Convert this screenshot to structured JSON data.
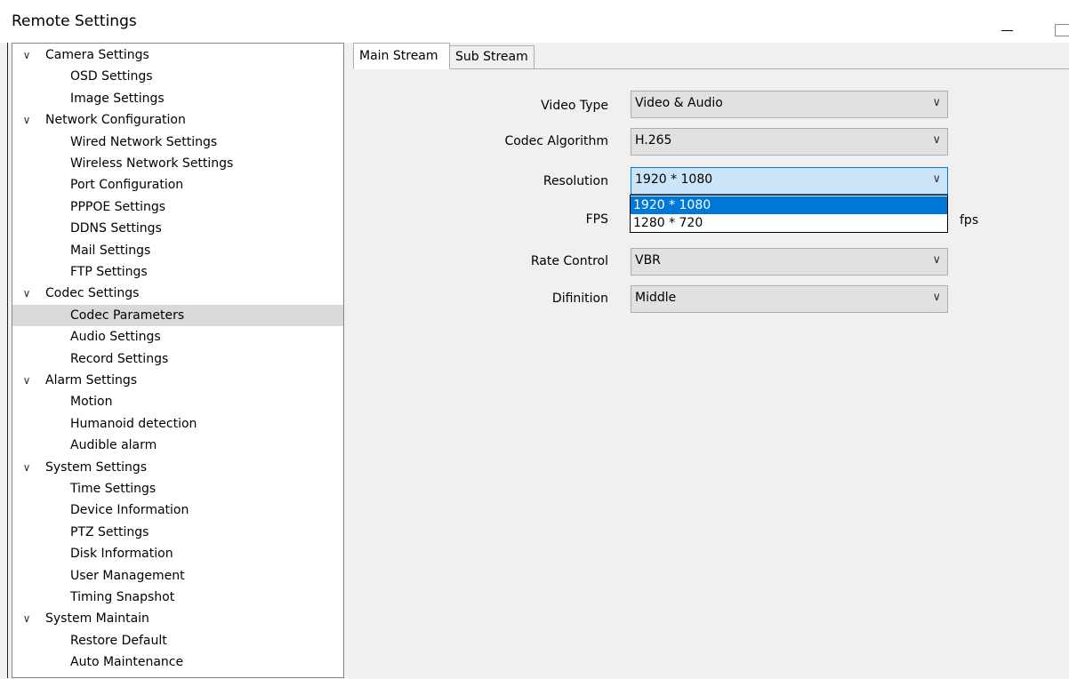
{
  "window": {
    "title": "Remote Settings"
  },
  "tree": [
    {
      "label": "Camera Settings",
      "level": 0,
      "name": "tree-camera-settings"
    },
    {
      "label": "OSD Settings",
      "level": 1,
      "name": "tree-osd-settings"
    },
    {
      "label": "Image Settings",
      "level": 1,
      "name": "tree-image-settings"
    },
    {
      "label": "Network Configuration",
      "level": 0,
      "name": "tree-network-configuration"
    },
    {
      "label": "Wired Network Settings",
      "level": 1,
      "name": "tree-wired-network-settings"
    },
    {
      "label": "Wireless Network Settings",
      "level": 1,
      "name": "tree-wireless-network-settings"
    },
    {
      "label": "Port Configuration",
      "level": 1,
      "name": "tree-port-configuration"
    },
    {
      "label": "PPPOE Settings",
      "level": 1,
      "name": "tree-pppoe-settings"
    },
    {
      "label": "DDNS Settings",
      "level": 1,
      "name": "tree-ddns-settings"
    },
    {
      "label": "Mail Settings",
      "level": 1,
      "name": "tree-mail-settings"
    },
    {
      "label": "FTP Settings",
      "level": 1,
      "name": "tree-ftp-settings"
    },
    {
      "label": "Codec Settings",
      "level": 0,
      "name": "tree-codec-settings"
    },
    {
      "label": "Codec Parameters",
      "level": 1,
      "name": "tree-codec-parameters",
      "selected": true
    },
    {
      "label": "Audio Settings",
      "level": 1,
      "name": "tree-audio-settings"
    },
    {
      "label": "Record Settings",
      "level": 1,
      "name": "tree-record-settings"
    },
    {
      "label": "Alarm Settings",
      "level": 0,
      "name": "tree-alarm-settings"
    },
    {
      "label": "Motion",
      "level": 1,
      "name": "tree-motion"
    },
    {
      "label": "Humanoid detection",
      "level": 1,
      "name": "tree-humanoid-detection"
    },
    {
      "label": "Audible alarm",
      "level": 1,
      "name": "tree-audible-alarm"
    },
    {
      "label": "System Settings",
      "level": 0,
      "name": "tree-system-settings"
    },
    {
      "label": "Time Settings",
      "level": 1,
      "name": "tree-time-settings"
    },
    {
      "label": "Device Information",
      "level": 1,
      "name": "tree-device-information"
    },
    {
      "label": "PTZ Settings",
      "level": 1,
      "name": "tree-ptz-settings"
    },
    {
      "label": "Disk Information",
      "level": 1,
      "name": "tree-disk-information"
    },
    {
      "label": "User Management",
      "level": 1,
      "name": "tree-user-management"
    },
    {
      "label": "Timing Snapshot",
      "level": 1,
      "name": "tree-timing-snapshot"
    },
    {
      "label": "System Maintain",
      "level": 0,
      "name": "tree-system-maintain"
    },
    {
      "label": "Restore Default",
      "level": 1,
      "name": "tree-restore-default"
    },
    {
      "label": "Auto Maintenance",
      "level": 1,
      "name": "tree-auto-maintenance"
    }
  ],
  "tabs": {
    "main": "Main Stream",
    "sub": "Sub Stream"
  },
  "form": {
    "video_type": {
      "label": "Video Type",
      "value": "Video & Audio"
    },
    "codec": {
      "label": "Codec Algorithm",
      "value": "H.265"
    },
    "resolution": {
      "label": "Resolution",
      "value": "1920 * 1080",
      "options": [
        "1920 * 1080",
        "1280 * 720"
      ]
    },
    "fps": {
      "label": "FPS",
      "unit": "fps"
    },
    "rate_control": {
      "label": "Rate Control",
      "value": "VBR"
    },
    "definition": {
      "label": "Difinition",
      "value": "Middle"
    }
  },
  "icons": {
    "expand": "chevron-down-icon",
    "combo": "chevron-down-icon"
  },
  "colors": {
    "selection": "#0078d7",
    "tree_selected": "#d9d9d9",
    "combo_focus": "#cce4f7"
  }
}
